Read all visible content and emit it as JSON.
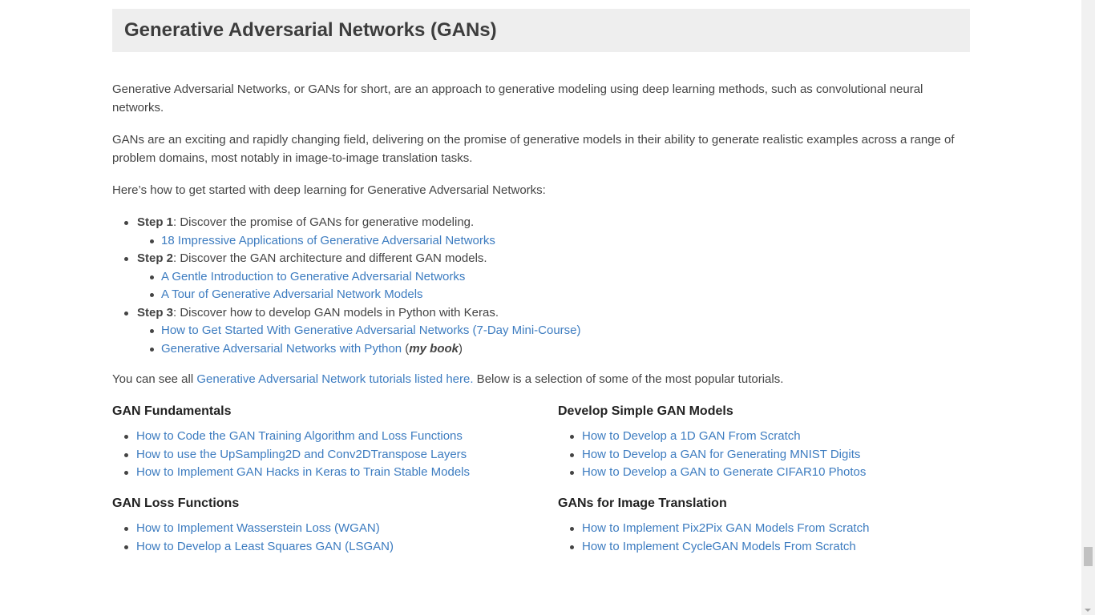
{
  "section": {
    "title": "Generative Adversarial Networks (GANs)"
  },
  "intro": {
    "p1": "Generative Adversarial Networks, or GANs for short, are an approach to generative modeling using deep learning methods, such as convolutional neural networks.",
    "p2": "GANs are an exciting and rapidly changing field, delivering on the promise of generative models in their ability to generate realistic examples across a range of problem domains, most notably in image-to-image translation tasks.",
    "p3": "Here’s how to get started with deep learning for Generative Adversarial Networks:"
  },
  "steps": [
    {
      "label": "Step 1",
      "text": ": Discover the promise of GANs for generative modeling.",
      "links": [
        "18 Impressive Applications of Generative Adversarial Networks"
      ]
    },
    {
      "label": "Step 2",
      "text": ": Discover the GAN architecture and different GAN models.",
      "links": [
        "A Gentle Introduction to Generative Adversarial Networks",
        "A Tour of Generative Adversarial Network Models"
      ]
    },
    {
      "label": "Step 3",
      "text": ": Discover how to develop GAN models in Python with Keras.",
      "links": [
        "How to Get Started With Generative Adversarial Networks (7-Day Mini-Course)",
        "Generative Adversarial Networks with Python"
      ]
    }
  ],
  "book_note": {
    "open": " (",
    "emphasis": "my book",
    "close": ")"
  },
  "see_all": {
    "prefix": "You can see all ",
    "link": "Generative Adversarial Network tutorials listed here.",
    "suffix": " Below is a selection of some of the most popular tutorials."
  },
  "columns": {
    "fundamentals": {
      "title": "GAN Fundamentals",
      "links": [
        "How to Code the GAN Training Algorithm and Loss Functions",
        "How to use the UpSampling2D and Conv2DTranspose Layers",
        "How to Implement GAN Hacks in Keras to Train Stable Models"
      ]
    },
    "simple_models": {
      "title": "Develop Simple GAN Models",
      "links": [
        "How to Develop a 1D GAN From Scratch",
        "How to Develop a GAN for Generating MNIST Digits",
        "How to Develop a GAN to Generate CIFAR10 Photos"
      ]
    },
    "loss_functions": {
      "title": "GAN Loss Functions",
      "links": [
        "How to Implement Wasserstein Loss (WGAN)",
        "How to Develop a Least Squares GAN (LSGAN)"
      ]
    },
    "image_translation": {
      "title": "GANs for Image Translation",
      "links": [
        "How to Implement Pix2Pix GAN Models From Scratch",
        "How to Implement CycleGAN Models From Scratch"
      ]
    }
  },
  "colors": {
    "link": "#3d7cc0",
    "heading_bg": "#eeeeee",
    "text": "#444444"
  }
}
